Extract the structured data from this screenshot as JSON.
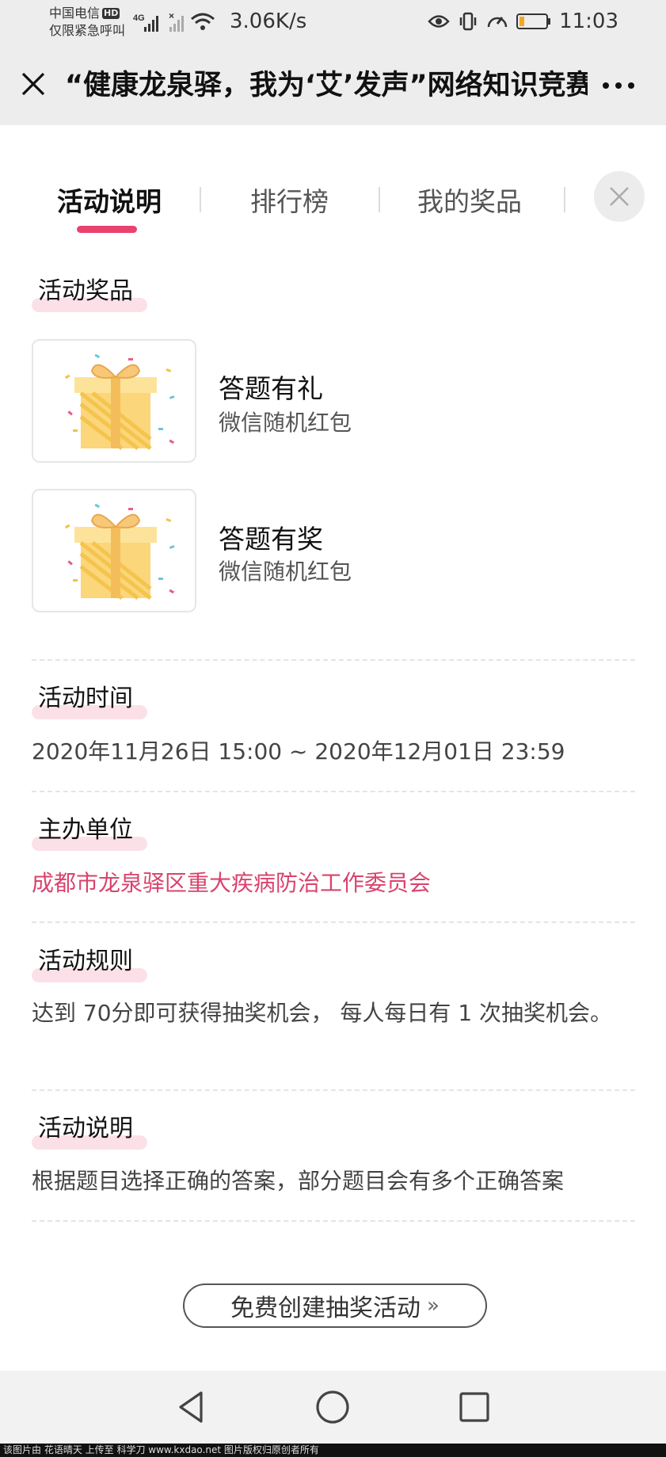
{
  "status_bar": {
    "carrier": "中国电信",
    "hd_badge": "HD",
    "emergency": "仅限紧急呼叫",
    "network": "4G",
    "speed": "3.06K/s",
    "time": "11:03",
    "battery_level": 0.2
  },
  "titlebar": {
    "title": "“健康龙泉驿，我为‘艾’发声”网络知识竞赛"
  },
  "tabs": [
    {
      "label": "活动说明",
      "active": true
    },
    {
      "label": "排行榜",
      "active": false
    },
    {
      "label": "我的奖品",
      "active": false
    }
  ],
  "sections": {
    "prizes": {
      "title": "活动奖品",
      "items": [
        {
          "name": "答题有礼",
          "desc": "微信随机红包"
        },
        {
          "name": "答题有奖",
          "desc": "微信随机红包"
        }
      ]
    },
    "time": {
      "title": "活动时间",
      "value": "2020年11月26日 15:00 ~ 2020年12月01日 23:59"
    },
    "organizer": {
      "title": "主办单位",
      "value": "成都市龙泉驿区重大疾病防治工作委员会"
    },
    "rules": {
      "title": "活动规则",
      "value": "达到 70分即可获得抽奖机会， 每人每日有 1 次抽奖机会。"
    },
    "description": {
      "title": "活动说明",
      "value": "根据题目选择正确的答案，部分题目会有多个正确答案"
    }
  },
  "cta": {
    "label": "免费创建抽奖活动",
    "chevron": "»"
  },
  "watermark": "该图片由  花语晴天  上传至  科学刀  www.kxdao.net  图片版权归原创者所有",
  "colors": {
    "accent": "#e8436e",
    "organizer_text": "#d9436d",
    "highlight": "#fbe1e7",
    "header_bg": "#ededed"
  }
}
